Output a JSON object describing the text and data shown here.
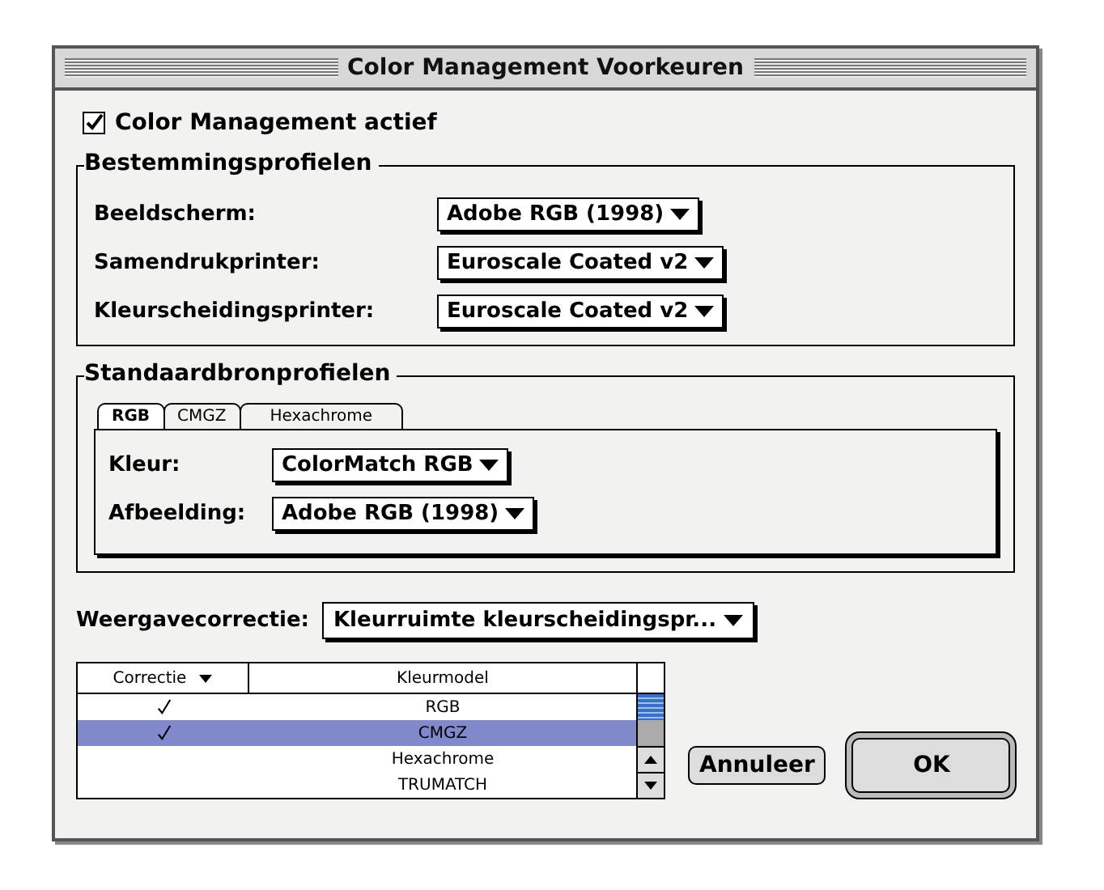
{
  "window": {
    "title": "Color Management Voorkeuren"
  },
  "enable": {
    "label": "Color Management actief",
    "checked": true
  },
  "destination": {
    "title": "Bestemmingsprofielen",
    "rows": [
      {
        "label": "Beeldscherm:",
        "value": "Adobe RGB (1998)"
      },
      {
        "label": "Samendrukprinter:",
        "value": "Euroscale Coated v2"
      },
      {
        "label": "Kleurscheidingsprinter:",
        "value": "Euroscale Coated v2"
      }
    ]
  },
  "source": {
    "title": "Standaardbronprofielen",
    "tabs": [
      {
        "label": "RGB",
        "selected": true
      },
      {
        "label": "CMGZ",
        "selected": false
      },
      {
        "label": "Hexachrome",
        "selected": false
      }
    ],
    "rows": [
      {
        "label": "Kleur:",
        "value": "ColorMatch RGB"
      },
      {
        "label": "Afbeelding:",
        "value": "Adobe RGB (1998)"
      }
    ]
  },
  "display_correction": {
    "label": "Weergavecorrectie:",
    "value": "Kleurruimte kleurscheidingspr..."
  },
  "table": {
    "columns": [
      "Correctie",
      "Kleurmodel"
    ],
    "rows": [
      {
        "checked": true,
        "model": "RGB",
        "selected": false
      },
      {
        "checked": true,
        "model": "CMGZ",
        "selected": true
      },
      {
        "checked": false,
        "model": "Hexachrome",
        "selected": false
      },
      {
        "checked": false,
        "model": "TRUMATCH",
        "selected": false
      }
    ]
  },
  "buttons": [
    {
      "label": "Annuleer",
      "default": false
    },
    {
      "label": "OK",
      "default": true
    }
  ]
}
